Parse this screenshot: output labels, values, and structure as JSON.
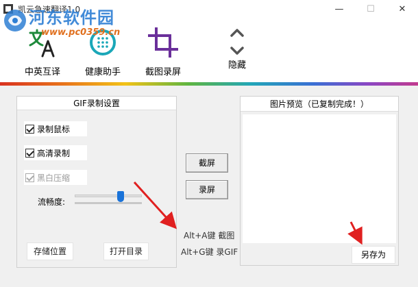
{
  "window": {
    "title": "凯云急速翻译1.0",
    "minimize": "—",
    "maximize": "☐",
    "close": "✕"
  },
  "watermark": {
    "site_name": "河东软件园",
    "url": "www.pc0359.cn"
  },
  "toolbar": {
    "translate_label": "中英互译",
    "health_label": "健康助手",
    "capture_label": "截图录屏",
    "hide_label": "隐藏"
  },
  "gif_settings": {
    "title": "GIF录制设置",
    "record_mouse": "录制鼠标",
    "hd_record": "高清录制",
    "bw_compress": "黑白压缩",
    "fluency_label": "流畅度:",
    "fluency_level": 0.7,
    "save_location": "存储位置",
    "open_directory": "打开目录"
  },
  "actions": {
    "screenshot": "截屏",
    "record": "录屏",
    "hotkey_screenshot": "Alt+A键 截图",
    "hotkey_gif": "Alt+G键 录GIF"
  },
  "preview": {
    "title": "图片预览（已复制完成！）",
    "save_as": "另存为"
  },
  "colors": {
    "accent": "#1a73d9",
    "icon_green": "#1e8a3c",
    "icon_teal": "#1ba7b8",
    "icon_purple": "#6a2f9a",
    "arrow_red": "#e02020"
  }
}
